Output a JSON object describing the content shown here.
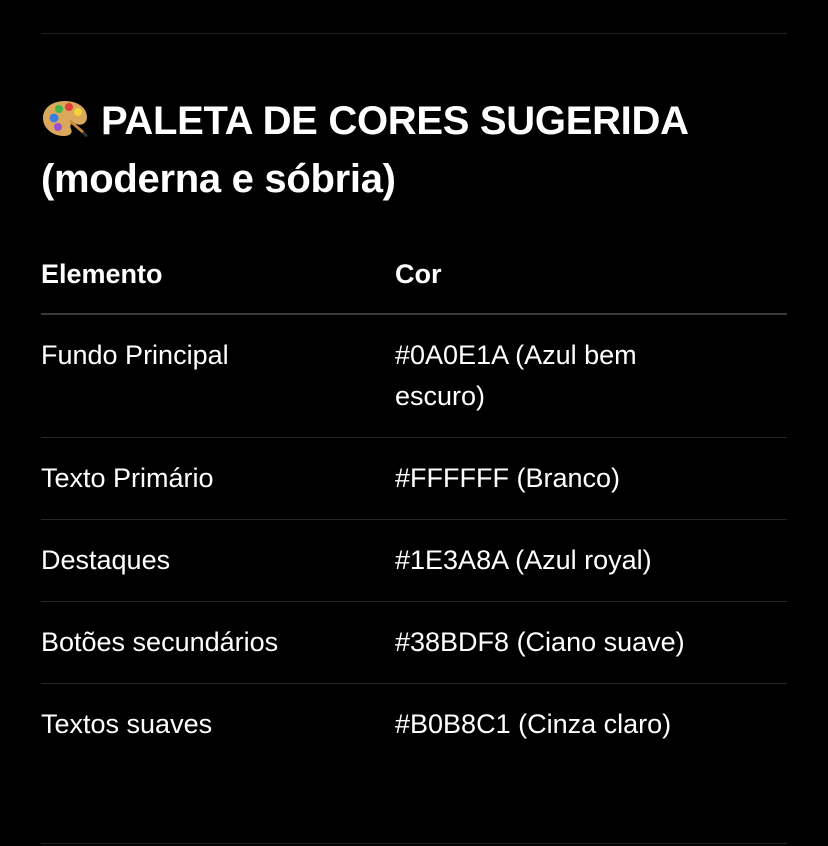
{
  "section": {
    "icon": "artist-palette-icon",
    "title": "PALETA DE CORES SUGERIDA (moderna e sóbria)"
  },
  "table": {
    "headers": [
      "Elemento",
      "Cor"
    ],
    "rows": [
      {
        "element": "Fundo Principal",
        "color": "#0A0E1A (Azul bem escuro)"
      },
      {
        "element": "Texto Primário",
        "color": "#FFFFFF (Branco)"
      },
      {
        "element": "Destaques",
        "color": "#1E3A8A (Azul royal)"
      },
      {
        "element": "Botões secundários",
        "color": "#38BDF8 (Ciano suave)"
      },
      {
        "element": "Textos suaves",
        "color": "#B0B8C1 (Cinza claro)"
      }
    ]
  }
}
